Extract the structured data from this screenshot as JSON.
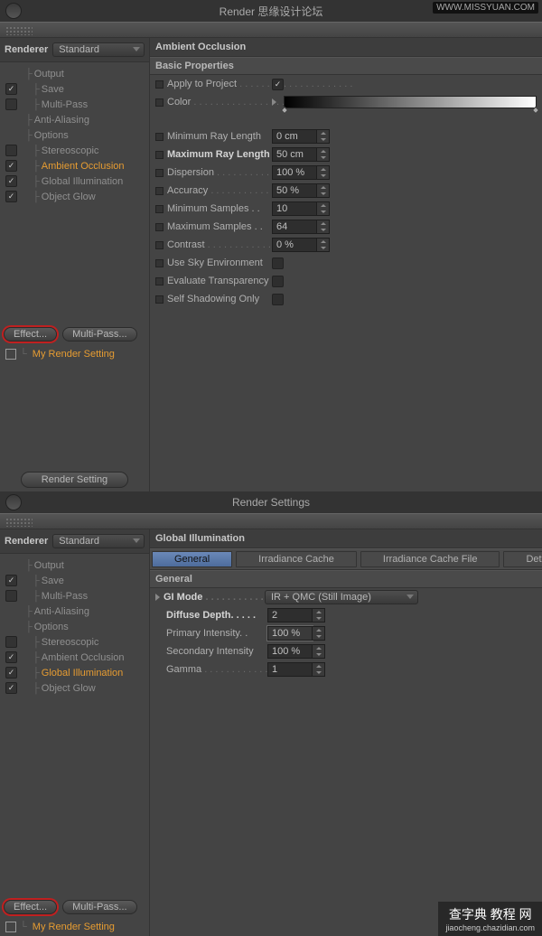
{
  "panel1": {
    "title": "Render 思缘设计论坛",
    "branding": "WWW.MISSYUAN.COM",
    "renderer_label": "Renderer",
    "renderer_value": "Standard",
    "tree": [
      {
        "label": "Output",
        "cb": null
      },
      {
        "label": "Save",
        "cb": true
      },
      {
        "label": "Multi-Pass",
        "cb": false
      },
      {
        "label": "Anti-Aliasing",
        "cb": null
      },
      {
        "label": "Options",
        "cb": null
      },
      {
        "label": "Stereoscopic",
        "cb": false
      },
      {
        "label": "Ambient Occlusion",
        "cb": true,
        "active": true
      },
      {
        "label": "Global Illumination",
        "cb": true
      },
      {
        "label": "Object Glow",
        "cb": true
      }
    ],
    "effect_btn": "Effect...",
    "multipass_btn": "Multi-Pass...",
    "preset": "My Render Setting",
    "footer_btn": "Render Setting",
    "section_title": "Ambient Occlusion",
    "section_sub": "Basic Properties",
    "props": {
      "apply_to_project": {
        "label": "Apply to Project",
        "checked": true
      },
      "color": {
        "label": "Color"
      },
      "min_ray": {
        "label": "Minimum Ray Length",
        "value": "0 cm"
      },
      "max_ray": {
        "label": "Maximum Ray Length",
        "value": "50 cm",
        "bold": true
      },
      "dispersion": {
        "label": "Dispersion",
        "value": "100 %"
      },
      "accuracy": {
        "label": "Accuracy",
        "value": "50 %"
      },
      "min_samples": {
        "label": "Minimum Samples",
        "value": "10"
      },
      "max_samples": {
        "label": "Maximum Samples",
        "value": "64"
      },
      "contrast": {
        "label": "Contrast",
        "value": "0 %"
      },
      "use_sky": {
        "label": "Use Sky Environment",
        "checked": false
      },
      "eval_trans": {
        "label": "Evaluate Transparency",
        "checked": false
      },
      "self_shadow": {
        "label": "Self Shadowing Only",
        "checked": false
      }
    }
  },
  "panel2": {
    "title": "Render Settings",
    "renderer_label": "Renderer",
    "renderer_value": "Standard",
    "tree": [
      {
        "label": "Output",
        "cb": null
      },
      {
        "label": "Save",
        "cb": true
      },
      {
        "label": "Multi-Pass",
        "cb": false
      },
      {
        "label": "Anti-Aliasing",
        "cb": null
      },
      {
        "label": "Options",
        "cb": null
      },
      {
        "label": "Stereoscopic",
        "cb": false
      },
      {
        "label": "Ambient Occlusion",
        "cb": true
      },
      {
        "label": "Global Illumination",
        "cb": true,
        "active": true
      },
      {
        "label": "Object Glow",
        "cb": true
      }
    ],
    "effect_btn": "Effect...",
    "multipass_btn": "Multi-Pass...",
    "preset": "My Render Setting",
    "section_title": "Global Illumination",
    "tabs": [
      "General",
      "Irradiance Cache",
      "Irradiance Cache File",
      "Details"
    ],
    "active_tab": 0,
    "section_sub": "General",
    "props": {
      "gi_mode": {
        "label": "GI Mode",
        "value": "IR + QMC (Still Image)"
      },
      "diffuse_depth": {
        "label": "Diffuse Depth",
        "value": "2"
      },
      "primary_intensity": {
        "label": "Primary Intensity",
        "value": "100 %"
      },
      "secondary_intensity": {
        "label": "Secondary Intensity",
        "value": "100 %"
      },
      "gamma": {
        "label": "Gamma",
        "value": "1"
      }
    }
  },
  "watermark": {
    "main": "查字典 教程 网",
    "sub": "jiaocheng.chazidian.com"
  }
}
